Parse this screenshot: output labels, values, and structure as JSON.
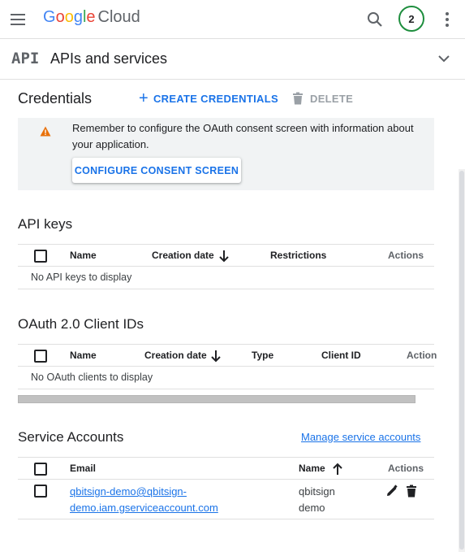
{
  "topbar": {
    "logo_google": [
      "G",
      "o",
      "o",
      "g",
      "l",
      "e"
    ],
    "logo_cloud": "Cloud",
    "avatar_text": "2",
    "icons": [
      "menu-icon",
      "search-icon",
      "more-vert-icon"
    ]
  },
  "product": {
    "icon_text": "API",
    "title": "APIs and services",
    "icon": "chevron-down-icon"
  },
  "credentials": {
    "title": "Credentials",
    "create_label": "CREATE CREDENTIALS",
    "delete_label": "DELETE"
  },
  "warning": {
    "text": "Remember to configure the OAuth consent screen with information about your application.",
    "button_label": "CONFIGURE CONSENT SCREEN",
    "icon": "warning-icon"
  },
  "api_keys": {
    "title": "API keys",
    "columns": [
      "Name",
      "Creation date",
      "Restrictions",
      "Actions"
    ],
    "empty_text": "No API keys to display"
  },
  "oauth": {
    "title": "OAuth 2.0 Client IDs",
    "columns": [
      "Name",
      "Creation date",
      "Type",
      "Client ID",
      "Action"
    ],
    "empty_text": "No OAuth clients to display"
  },
  "service_accounts": {
    "title": "Service Accounts",
    "manage_link": "Manage service accounts",
    "columns": [
      "Email",
      "Name",
      "Actions"
    ],
    "rows": [
      {
        "email": "qbitsign-demo@qbitsign-demo.iam.gserviceaccount.com",
        "name": "qbitsign demo"
      }
    ]
  },
  "colors": {
    "accent": "#1a73e8",
    "warning": "#e8710a",
    "avatar_ring": "#1e8e3e"
  }
}
